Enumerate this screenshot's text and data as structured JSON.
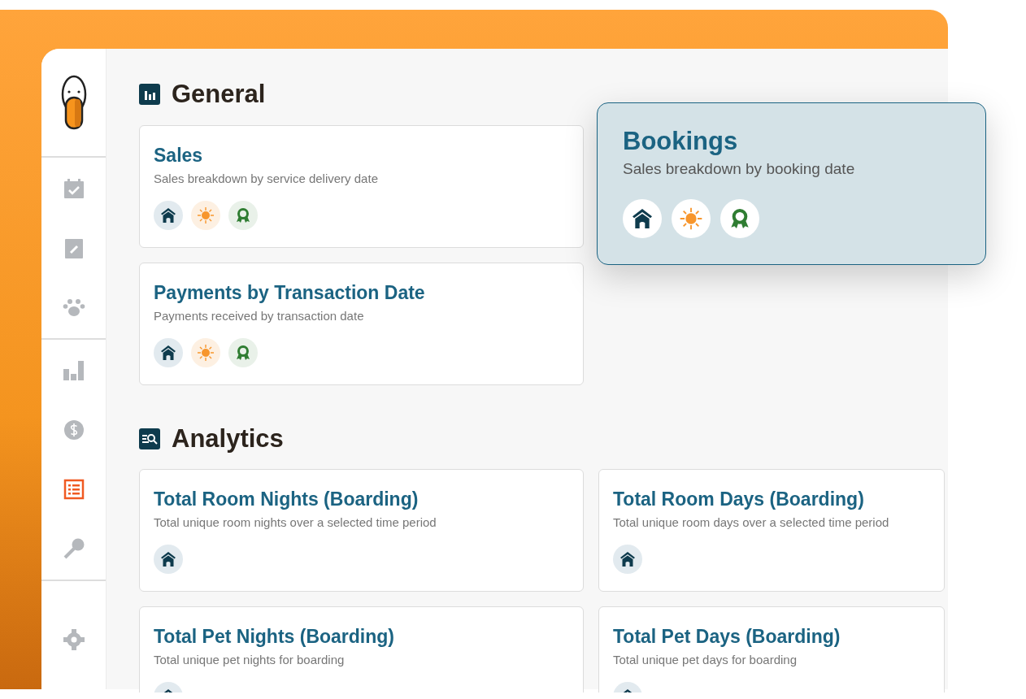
{
  "sidebar": {
    "groups": [
      {
        "items": [
          {
            "kind": "calendar",
            "selected": false
          },
          {
            "kind": "clipboard",
            "selected": false
          },
          {
            "kind": "paw",
            "selected": false
          }
        ]
      },
      {
        "items": [
          {
            "kind": "bars",
            "selected": false
          },
          {
            "kind": "dollar",
            "selected": false
          },
          {
            "kind": "list",
            "selected": true
          },
          {
            "kind": "key",
            "selected": false
          }
        ]
      },
      {
        "items": [
          {
            "kind": "gear",
            "selected": false
          }
        ]
      }
    ]
  },
  "sections": [
    {
      "title": "General",
      "kind": "chart",
      "cards": [
        {
          "title": "Sales",
          "description": "Sales breakdown by service delivery date",
          "highlighted": false,
          "tags": [
            {
              "kind": "house"
            },
            {
              "kind": "sun"
            },
            {
              "kind": "ribbon"
            }
          ]
        },
        {
          "title": "Bookings",
          "description": "Sales breakdown by booking date",
          "highlighted": true,
          "tags": [
            {
              "kind": "house"
            },
            {
              "kind": "sun"
            },
            {
              "kind": "ribbon"
            }
          ]
        },
        {
          "title": "Payments by Transaction Date",
          "description": "Payments received by transaction date",
          "highlighted": false,
          "tags": [
            {
              "kind": "house"
            },
            {
              "kind": "sun"
            },
            {
              "kind": "ribbon"
            }
          ]
        }
      ]
    },
    {
      "title": "Analytics",
      "kind": "search",
      "cards": [
        {
          "title": "Total Room Nights (Boarding)",
          "description": "Total unique room nights over a selected time period",
          "highlighted": false,
          "tags": [
            {
              "kind": "house"
            }
          ]
        },
        {
          "title": "Total Room Days (Boarding)",
          "description": "Total unique room days over a selected time period",
          "highlighted": false,
          "tags": [
            {
              "kind": "house"
            }
          ]
        },
        {
          "title": "Total Pet Nights (Boarding)",
          "description": "Total unique pet nights for boarding",
          "highlighted": false,
          "tags": [
            {
              "kind": "house"
            }
          ]
        },
        {
          "title": "Total Pet Days (Boarding)",
          "description": "Total unique pet days for boarding",
          "highlighted": false,
          "tags": [
            {
              "kind": "house"
            }
          ]
        }
      ]
    }
  ]
}
